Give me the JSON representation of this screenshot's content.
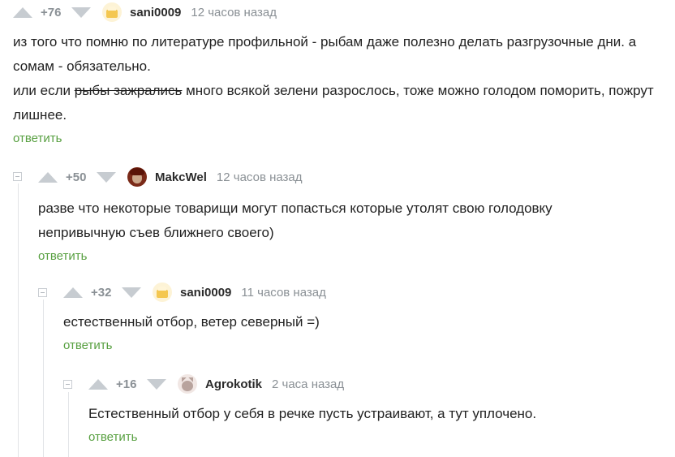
{
  "comments": [
    {
      "rating": "+76",
      "username": "sani0009",
      "time": "12 часов назад",
      "avatar_icon": "cake-avatar",
      "text_p1": "из того что помню по литературе профильной - рыбам даже полезно делать разгрузочные дни. а сомам - обязательно.",
      "text_p2_before": "или если ",
      "text_p2_strike": "рыбы зажрались",
      "text_p2_after": " много всякой зелени разрослось, тоже можно голодом поморить, пожрут лишнее.",
      "reply_label": "ответить"
    },
    {
      "rating": "+50",
      "username": "MakcWel",
      "time": "12 часов назад",
      "avatar_icon": "portrait-avatar",
      "text": "разве что некоторые товарищи могут попасться которые утолят свою голодовку непривычную съев ближнего своего)",
      "reply_label": "ответить"
    },
    {
      "rating": "+32",
      "username": "sani0009",
      "time": "11 часов назад",
      "avatar_icon": "cake-avatar",
      "text": "естественный отбор, ветер северный =)",
      "reply_label": "ответить"
    },
    {
      "rating": "+16",
      "username": "Agrokotik",
      "time": "2 часа назад",
      "avatar_icon": "cat-avatar",
      "text": "Естественный отбор у себя в речке пусть устраивают, а тут уплочено.",
      "reply_label": "ответить"
    }
  ],
  "colors": {
    "reply_green": "#58a041",
    "meta_gray": "#8a9095",
    "vote_arrow": "#c7ccd1"
  }
}
